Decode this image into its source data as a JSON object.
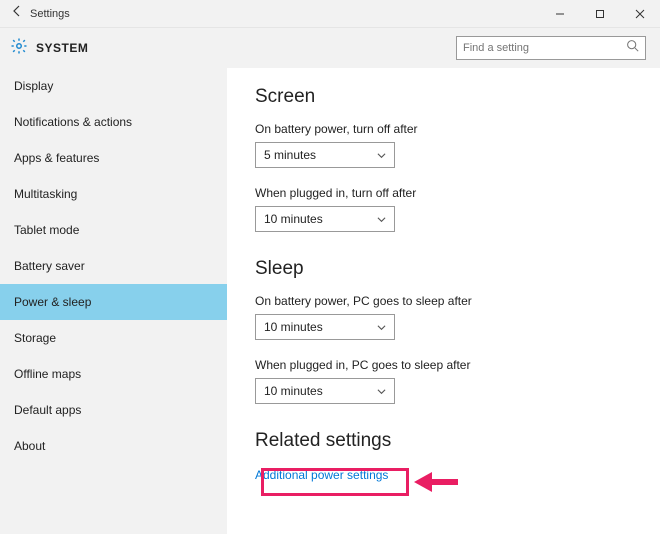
{
  "window": {
    "title": "Settings"
  },
  "header": {
    "title": "SYSTEM",
    "search_placeholder": "Find a setting"
  },
  "sidebar": {
    "items": [
      {
        "label": "Display"
      },
      {
        "label": "Notifications & actions"
      },
      {
        "label": "Apps & features"
      },
      {
        "label": "Multitasking"
      },
      {
        "label": "Tablet mode"
      },
      {
        "label": "Battery saver"
      },
      {
        "label": "Power & sleep"
      },
      {
        "label": "Storage"
      },
      {
        "label": "Offline maps"
      },
      {
        "label": "Default apps"
      },
      {
        "label": "About"
      }
    ],
    "selected_index": 6
  },
  "content": {
    "screen": {
      "heading": "Screen",
      "battery_label": "On battery power, turn off after",
      "battery_value": "5 minutes",
      "plugged_label": "When plugged in, turn off after",
      "plugged_value": "10 minutes"
    },
    "sleep": {
      "heading": "Sleep",
      "battery_label": "On battery power, PC goes to sleep after",
      "battery_value": "10 minutes",
      "plugged_label": "When plugged in, PC goes to sleep after",
      "plugged_value": "10 minutes"
    },
    "related": {
      "heading": "Related settings",
      "link": "Additional power settings"
    }
  }
}
